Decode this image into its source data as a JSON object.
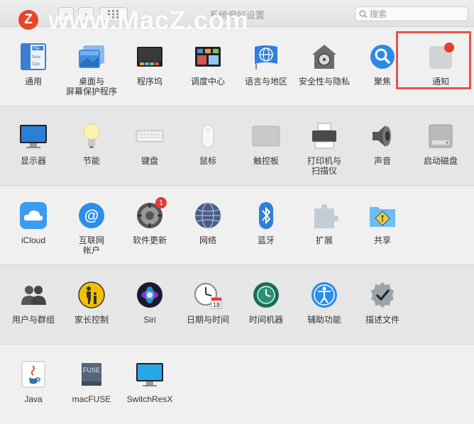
{
  "watermark": {
    "logo_letter": "Z",
    "text": "www.MacZ.com"
  },
  "window": {
    "title": "系统偏好设置",
    "back_glyph": "‹",
    "forward_glyph": "›"
  },
  "search": {
    "placeholder": "搜索"
  },
  "accent_color": "#e2554d",
  "rows": [
    {
      "items": [
        {
          "name": "general",
          "label": "通用",
          "icon": "general-icon"
        },
        {
          "name": "desktop-screensaver",
          "label": "桌面与\n屏幕保护程序",
          "icon": "desktop-icon"
        },
        {
          "name": "dock",
          "label": "程序坞",
          "icon": "dock-icon"
        },
        {
          "name": "mission-control",
          "label": "调度中心",
          "icon": "mission-control-icon"
        },
        {
          "name": "language-region",
          "label": "语言与地区",
          "icon": "globe-flag-icon"
        },
        {
          "name": "security-privacy",
          "label": "安全性与隐私",
          "icon": "house-lock-icon"
        },
        {
          "name": "spotlight",
          "label": "聚焦",
          "icon": "magnifier-icon"
        },
        {
          "name": "notifications",
          "label": "通知",
          "icon": "notification-icon"
        }
      ]
    },
    {
      "items": [
        {
          "name": "displays",
          "label": "显示器",
          "icon": "display-icon"
        },
        {
          "name": "energy-saver",
          "label": "节能",
          "icon": "lightbulb-icon"
        },
        {
          "name": "keyboard",
          "label": "键盘",
          "icon": "keyboard-icon"
        },
        {
          "name": "mouse",
          "label": "鼠标",
          "icon": "mouse-icon"
        },
        {
          "name": "trackpad",
          "label": "触控板",
          "icon": "trackpad-icon"
        },
        {
          "name": "printers-scanners",
          "label": "打印机与\n扫描仪",
          "icon": "printer-icon"
        },
        {
          "name": "sound",
          "label": "声音",
          "icon": "speaker-icon"
        },
        {
          "name": "startup-disk",
          "label": "启动磁盘",
          "icon": "disk-icon"
        }
      ]
    },
    {
      "items": [
        {
          "name": "icloud",
          "label": "iCloud",
          "icon": "cloud-icon"
        },
        {
          "name": "internet-accounts",
          "label": "互联网\n帐户",
          "icon": "at-icon"
        },
        {
          "name": "software-update",
          "label": "软件更新",
          "icon": "gear-update-icon",
          "badge": "1"
        },
        {
          "name": "network",
          "label": "网络",
          "icon": "network-globe-icon"
        },
        {
          "name": "bluetooth",
          "label": "蓝牙",
          "icon": "bluetooth-icon"
        },
        {
          "name": "extensions",
          "label": "扩展",
          "icon": "puzzle-icon"
        },
        {
          "name": "sharing",
          "label": "共享",
          "icon": "sharing-folder-icon"
        }
      ]
    },
    {
      "items": [
        {
          "name": "users-groups",
          "label": "用户与群组",
          "icon": "users-icon"
        },
        {
          "name": "parental-controls",
          "label": "家长控制",
          "icon": "parental-icon"
        },
        {
          "name": "siri",
          "label": "Siri",
          "icon": "siri-icon"
        },
        {
          "name": "date-time",
          "label": "日期与时间",
          "icon": "clock-calendar-icon",
          "calendar_day": "18"
        },
        {
          "name": "time-machine",
          "label": "时间机器",
          "icon": "time-machine-icon"
        },
        {
          "name": "accessibility",
          "label": "辅助功能",
          "icon": "accessibility-icon"
        },
        {
          "name": "profiles",
          "label": "描述文件",
          "icon": "checkmark-badge-icon"
        }
      ]
    },
    {
      "items": [
        {
          "name": "java",
          "label": "Java",
          "icon": "java-icon"
        },
        {
          "name": "macfuse",
          "label": "macFUSE",
          "icon": "macfuse-icon",
          "icon_text": "FUSE"
        },
        {
          "name": "switchresx",
          "label": "SwitchResX",
          "icon": "switchresx-icon"
        }
      ]
    }
  ]
}
